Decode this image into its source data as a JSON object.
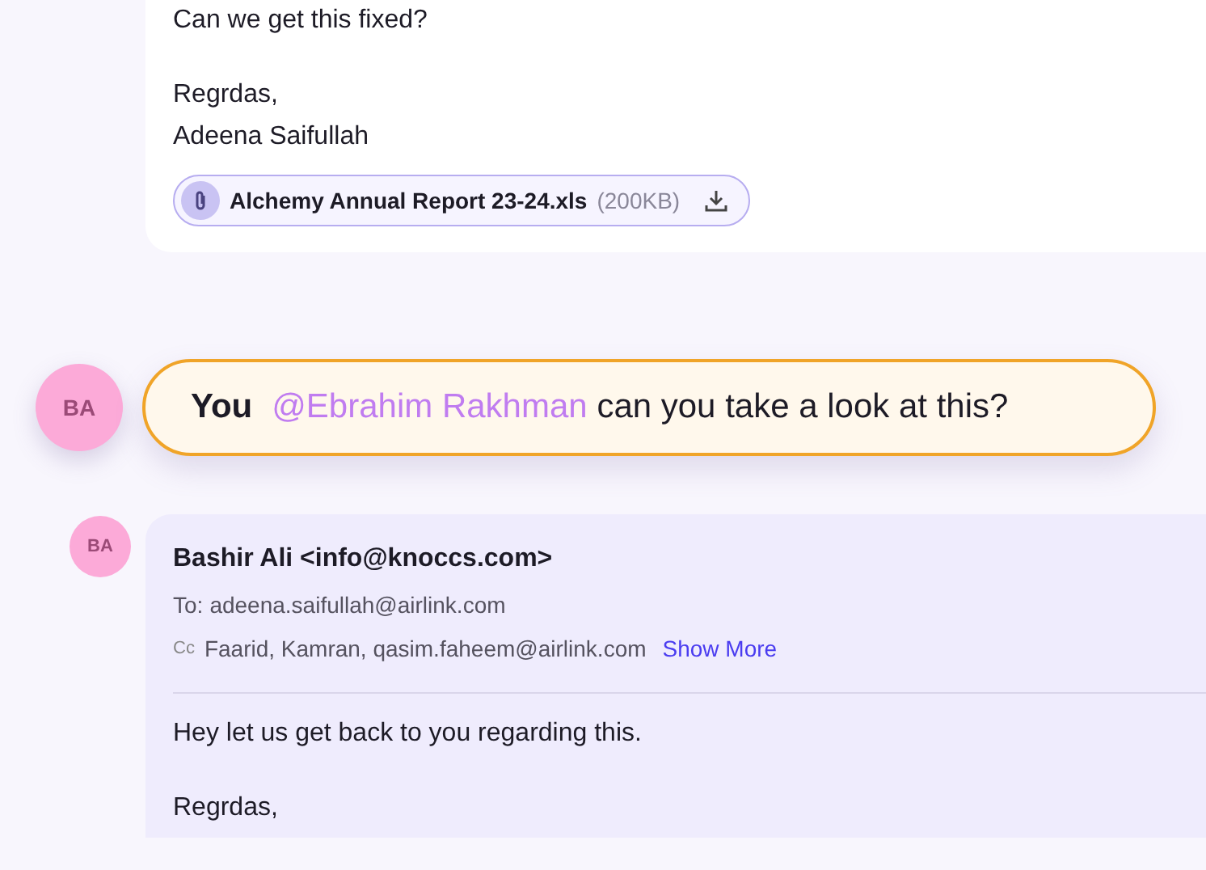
{
  "top_email": {
    "paragraphs": [
      [
        "Can we get this fixed?"
      ],
      [
        "Regrdas,",
        "Adeena Saifullah"
      ]
    ],
    "attachment": {
      "name": "Alchemy Annual Report 23-24.xls",
      "size": "(200KB)"
    }
  },
  "comment": {
    "avatar": "BA",
    "author": "You",
    "mention": "@Ebrahim Rakhman",
    "text": "can you take a look at this?"
  },
  "email": {
    "avatar": "BA",
    "sender": "Bashir Ali <info@knoccs.com>",
    "to_label": "To:",
    "to": "adeena.saifullah@airlink.com",
    "cc_label": "Cc",
    "cc": "Faarid, Kamran, qasim.faheem@airlink.com",
    "show_more": "Show More",
    "paragraphs": [
      [
        "Hey let us get back to you regarding this."
      ],
      [
        "Regrdas,"
      ]
    ]
  }
}
